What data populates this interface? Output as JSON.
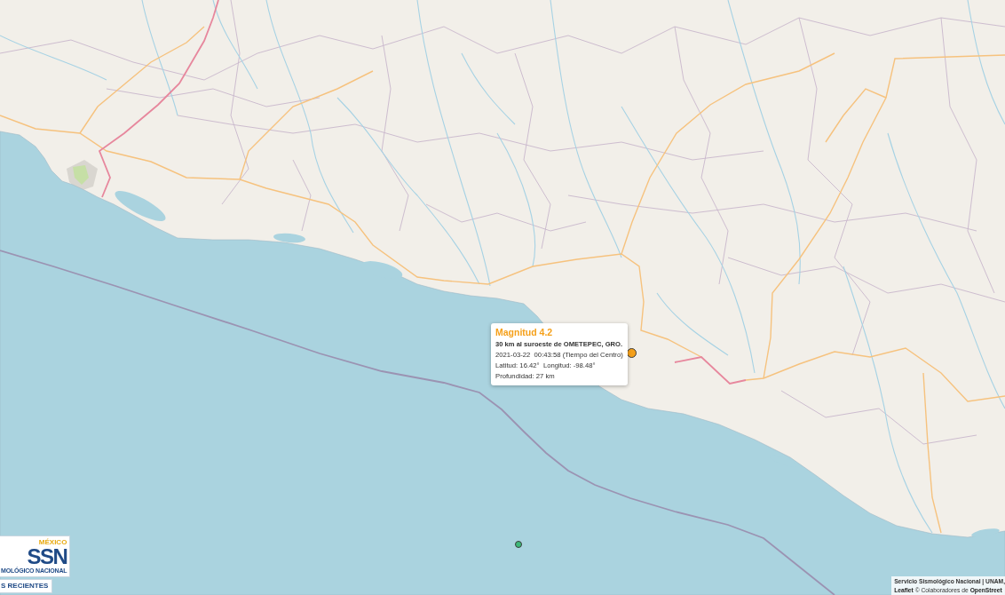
{
  "map": {
    "markers": [
      {
        "kind": "latest",
        "color": "#f5a01a"
      },
      {
        "kind": "past",
        "color": "#3cb878"
      }
    ]
  },
  "popup": {
    "title": "Magnitud 4.2",
    "location": "30 km al suroeste de OMETEPEC, GRO.",
    "datetime": "2021-03-22  00:43:58 (Tiempo del Centro)",
    "coordinates": "Latitud: 16.42°  Longitud: -98.48°",
    "depth": "Profundidad: 27 km"
  },
  "logo": {
    "country": "MÉXICO",
    "acronym": "SSN",
    "subtitle": "MOLÓGICO NACIONAL"
  },
  "recent_button": {
    "label": "S RECIENTES"
  },
  "attribution": {
    "provider": "Servicio Sismológico Nacional | UNAM,",
    "leaflet_link": "Leaflet",
    "credit": "© Colaboradores de",
    "osm_link": "OpenStreet"
  }
}
